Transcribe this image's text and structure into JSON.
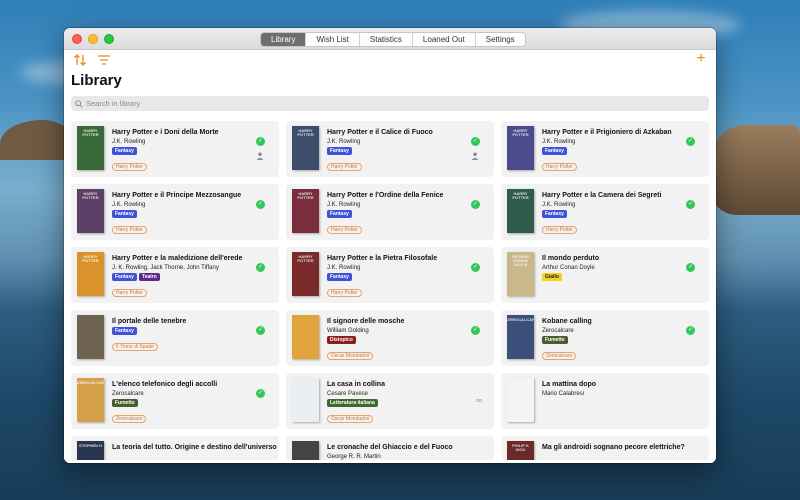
{
  "window": {
    "tabs": [
      {
        "label": "Library",
        "active": true
      },
      {
        "label": "Wish List",
        "active": false
      },
      {
        "label": "Statistics",
        "active": false
      },
      {
        "label": "Loaned Out",
        "active": false
      },
      {
        "label": "Settings",
        "active": false
      }
    ]
  },
  "page": {
    "title": "Library",
    "search_placeholder": "Search in library"
  },
  "colors": {
    "accent": "#f08a1c",
    "read_check": "#34c759",
    "series_outline": "#e9a36a"
  },
  "books": [
    {
      "title": "Harry Potter e i Doni della Morte",
      "author": "J.K. Rowling",
      "tags": [
        {
          "label": "Fantasy",
          "color": "#3d54d6"
        }
      ],
      "series": "Harry Potter",
      "status": "read",
      "loaned": true,
      "cover": "#3a6a3a",
      "cover_text": "HARRY POTTER"
    },
    {
      "title": "Harry Potter e il Calice di Fuoco",
      "author": "J.K. Rowling",
      "tags": [
        {
          "label": "Fantasy",
          "color": "#3d54d6"
        }
      ],
      "series": "Harry Potter",
      "status": "read",
      "loaned": true,
      "cover": "#3b4d6b",
      "cover_text": "HARRY POTTER"
    },
    {
      "title": "Harry Potter e il Prigioniero di Azkaban",
      "author": "J.K. Rowling",
      "tags": [
        {
          "label": "Fantasy",
          "color": "#3d54d6"
        }
      ],
      "series": "Harry Potter",
      "status": "read",
      "loaned": false,
      "cover": "#4b4a8a",
      "cover_text": "HARRY POTTER"
    },
    {
      "title": "Harry Potter e il Principe Mezzosangue",
      "author": "J.K. Rowling",
      "tags": [
        {
          "label": "Fantasy",
          "color": "#3d54d6"
        }
      ],
      "series": "Harry Potter",
      "status": "read",
      "loaned": false,
      "cover": "#5b3f66",
      "cover_text": "HARRY POTTER"
    },
    {
      "title": "Harry Potter e l'Ordine della Fenice",
      "author": "J.K. Rowling",
      "tags": [
        {
          "label": "Fantasy",
          "color": "#3d54d6"
        }
      ],
      "series": "Harry Potter",
      "status": "read",
      "loaned": false,
      "cover": "#7a2d3d",
      "cover_text": "HARRY POTTER"
    },
    {
      "title": "Harry Potter e la Camera dei Segreti",
      "author": "J.K. Rowling",
      "tags": [
        {
          "label": "Fantasy",
          "color": "#3d54d6"
        }
      ],
      "series": "Harry Potter",
      "status": "read",
      "loaned": false,
      "cover": "#2f5b4a",
      "cover_text": "HARRY POTTER"
    },
    {
      "title": "Harry Potter e la maledizione dell'erede",
      "author": "J. K. Rowling, Jack Thorne, John Tiffany",
      "tags": [
        {
          "label": "Fantasy",
          "color": "#3d54d6"
        },
        {
          "label": "Teatro",
          "color": "#5b2a86"
        }
      ],
      "series": "Harry Potter",
      "status": "read",
      "loaned": false,
      "cover": "#d9932a",
      "cover_text": "HARRY POTTER"
    },
    {
      "title": "Harry Potter e la Pietra Filosofale",
      "author": "J.K. Rowling",
      "tags": [
        {
          "label": "Fantasy",
          "color": "#3d54d6"
        }
      ],
      "series": "Harry Potter",
      "status": "read",
      "loaned": false,
      "cover": "#7a2a2a",
      "cover_text": "HARRY POTTER"
    },
    {
      "title": "Il mondo perduto",
      "author": "Arthur Conan Doyle",
      "tags": [
        {
          "label": "Giallo",
          "color": "#f2d21a"
        }
      ],
      "series": "",
      "status": "read",
      "loaned": false,
      "cover": "#c9b98a",
      "cover_text": "ARTHUR CONAN DOYLE"
    },
    {
      "title": "Il portale delle tenebre",
      "author": "",
      "tags": [
        {
          "label": "Fantasy",
          "color": "#3d54d6"
        }
      ],
      "series": "Il Trono di Spade",
      "status": "read",
      "loaned": false,
      "cover": "#6d6350",
      "cover_text": ""
    },
    {
      "title": "Il signore delle mosche",
      "author": "William Golding",
      "tags": [
        {
          "label": "Distopico",
          "color": "#8b1d1d"
        }
      ],
      "series": "Oscar Mondadori",
      "status": "read",
      "loaned": false,
      "cover": "#e0a43a",
      "cover_text": ""
    },
    {
      "title": "Kobane calling",
      "author": "Zerocalcare",
      "tags": [
        {
          "label": "Fumetto",
          "color": "#4a5c2c"
        }
      ],
      "series": "Zerocalcare",
      "status": "read",
      "loaned": false,
      "cover": "#3b4f7a",
      "cover_text": "ZEROCALCARE"
    },
    {
      "title": "L'elenco telefonico degli accolli",
      "author": "Zerocalcare",
      "tags": [
        {
          "label": "Fumetto",
          "color": "#4a5c2c"
        }
      ],
      "series": "Zerocalcare",
      "status": "read",
      "loaned": false,
      "cover": "#d4a14a",
      "cover_text": "ZEROCALCARE"
    },
    {
      "title": "La casa in collina",
      "author": "Cesare Pavese",
      "tags": [
        {
          "label": "Letteratura italiana",
          "color": "#3b6b2e"
        }
      ],
      "series": "Oscar Mondadori",
      "status": "reading",
      "loaned": false,
      "cover": "#e9eef2",
      "cover_text": ""
    },
    {
      "title": "La mattina dopo",
      "author": "Mario Calabresi",
      "tags": [],
      "series": "",
      "status": "none",
      "loaned": false,
      "cover": "#f4f4f4",
      "cover_text": ""
    },
    {
      "title": "La teoria del tutto. Origine e destino dell'universo",
      "author": "",
      "tags": [],
      "series": "",
      "status": "none",
      "loaned": false,
      "cover": "#2a3650",
      "cover_text": "STEPHEN H"
    },
    {
      "title": "Le cronache del Ghiaccio e del Fuoco",
      "author": "George R. R. Martin",
      "tags": [],
      "series": "",
      "status": "none",
      "loaned": false,
      "cover": "#444",
      "cover_text": ""
    },
    {
      "title": "Ma gli androidi sognano pecore elettriche?",
      "author": "",
      "tags": [],
      "series": "",
      "status": "none",
      "loaned": false,
      "cover": "#6b2a2a",
      "cover_text": "PHILIP K DICK"
    }
  ]
}
